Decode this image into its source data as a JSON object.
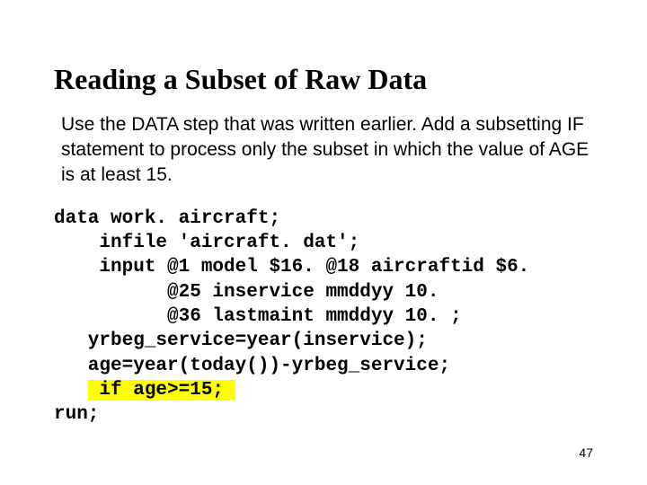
{
  "title": "Reading a Subset of Raw Data",
  "body": "Use the DATA step that was written earlier. Add a subsetting IF statement to process only the subset in which the value of AGE is at least 15.",
  "code": {
    "l1": "data work. aircraft;",
    "l2": "    infile 'aircraft. dat';",
    "l3": "    input @1 model $16. @18 aircraftid $6.",
    "l4": "          @25 inservice mmddyy 10.",
    "l5": "          @36 lastmaint mmddyy 10. ;",
    "l6": "   yrbeg_service=year(inservice);",
    "l7": "   age=year(today())-yrbeg_service;",
    "l8_prefix": "   ",
    "l8_hl": " if age>=15; ",
    "l9": "run;"
  },
  "page_number": "47"
}
